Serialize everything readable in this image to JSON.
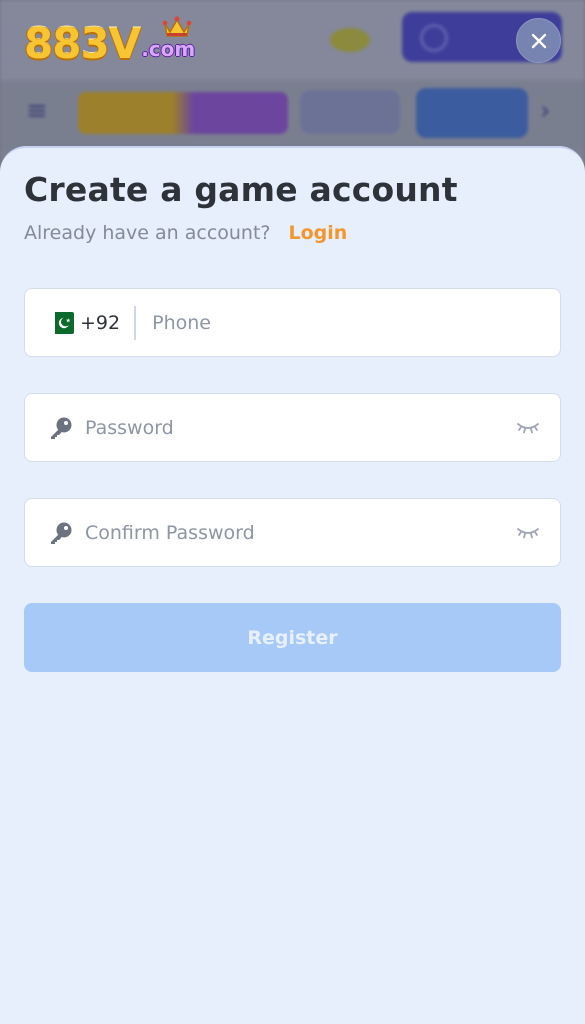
{
  "brand": {
    "logo_main": "883V",
    "logo_domain": ".com"
  },
  "background_page": {
    "menu_icon": "hamburger-icon",
    "arrow_icon": "chevron-right-icon"
  },
  "close_button": {
    "icon": "close-icon"
  },
  "form": {
    "title": "Create a game account",
    "subtitle": "Already have an account?",
    "login_link": "Login",
    "phone": {
      "country_flag": "pakistan-flag-icon",
      "country_code": "+92",
      "placeholder": "Phone"
    },
    "password": {
      "icon": "key-icon",
      "placeholder": "Password",
      "toggle_icon": "eye-closed-icon"
    },
    "confirm_password": {
      "icon": "key-icon",
      "placeholder": "Confirm Password",
      "toggle_icon": "eye-closed-icon"
    },
    "register_label": "Register"
  },
  "colors": {
    "sheet_background": "#e7effd",
    "accent_orange": "#f2962e",
    "register_button_disabled": "#a6c9f8",
    "title_text": "#2e3239",
    "placeholder_text": "#8e95a3"
  }
}
